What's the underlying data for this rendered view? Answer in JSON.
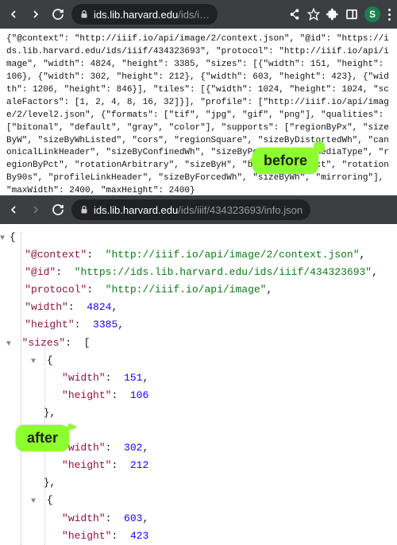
{
  "top_bar": {
    "back_enabled": true,
    "forward_enabled": true,
    "host": "ids.lib.harvard.edu",
    "path": "/ids/i…",
    "avatar_initial": "S"
  },
  "bottom_bar": {
    "back_enabled": true,
    "forward_enabled": false,
    "host": "ids.lib.harvard.edu",
    "path": "/ids/iiif/434323693/info.json"
  },
  "labels": {
    "before": "before",
    "after": "after"
  },
  "raw_json_text": "{\"@context\": \"http://iiif.io/api/image/2/context.json\", \"@id\": \"https://ids.lib.harvard.edu/ids/iiif/434323693\", \"protocol\": \"http://iiif.io/api/image\", \"width\": 4824, \"height\": 3385, \"sizes\": [{\"width\": 151, \"height\": 106}, {\"width\": 302, \"height\": 212}, {\"width\": 603, \"height\": 423}, {\"width\": 1206, \"height\": 846}], \"tiles\": [{\"width\": 1024, \"height\": 1024, \"scaleFactors\": [1, 2, 4, 8, 16, 32]}], \"profile\": [\"http://iiif.io/api/image/2/level2.json\", {\"formats\": [\"tif\", \"jpg\", \"gif\", \"png\"], \"qualities\": [\"bitonal\", \"default\", \"gray\", \"color\"], \"supports\": [\"regionByPx\", \"sizeByW\", \"sizeByWhListed\", \"cors\", \"regionSquare\", \"sizeByDistortedWh\", \"canonicalLinkHeader\", \"sizeByConfinedWh\", \"sizeByPct\", \"jsonldMediaType\", \"regionByPct\", \"rotationArbitrary\", \"sizeByH\", \"baseUriRedirect\", \"rotationBy90s\", \"profileLinkHeader\", \"sizeByForcedWh\", \"sizeByWh\", \"mirroring\"], \"maxWidth\": 2400, \"maxHeight\": 2400}",
  "formatted": {
    "context_key": "\"@context\"",
    "context_val": "\"http://iiif.io/api/image/2/context.json\"",
    "id_key": "\"@id\"",
    "id_val": "\"https://ids.lib.harvard.edu/ids/iiif/434323693\"",
    "protocol_key": "\"protocol\"",
    "protocol_val": "\"http://iiif.io/api/image\"",
    "width_key": "\"width\"",
    "width_val": "4824",
    "height_key": "\"height\"",
    "height_val": "3385",
    "sizes_key": "\"sizes\"",
    "s0_w_key": "\"width\"",
    "s0_w_val": "151",
    "s0_h_key": "\"height\"",
    "s0_h_val": "106",
    "s1_w_key": "\"width\"",
    "s1_w_val": "302",
    "s1_h_key": "\"height\"",
    "s1_h_val": "212",
    "s2_w_key": "\"width\"",
    "s2_w_val": "603",
    "s2_h_key": "\"height\"",
    "s2_h_val": "423"
  }
}
